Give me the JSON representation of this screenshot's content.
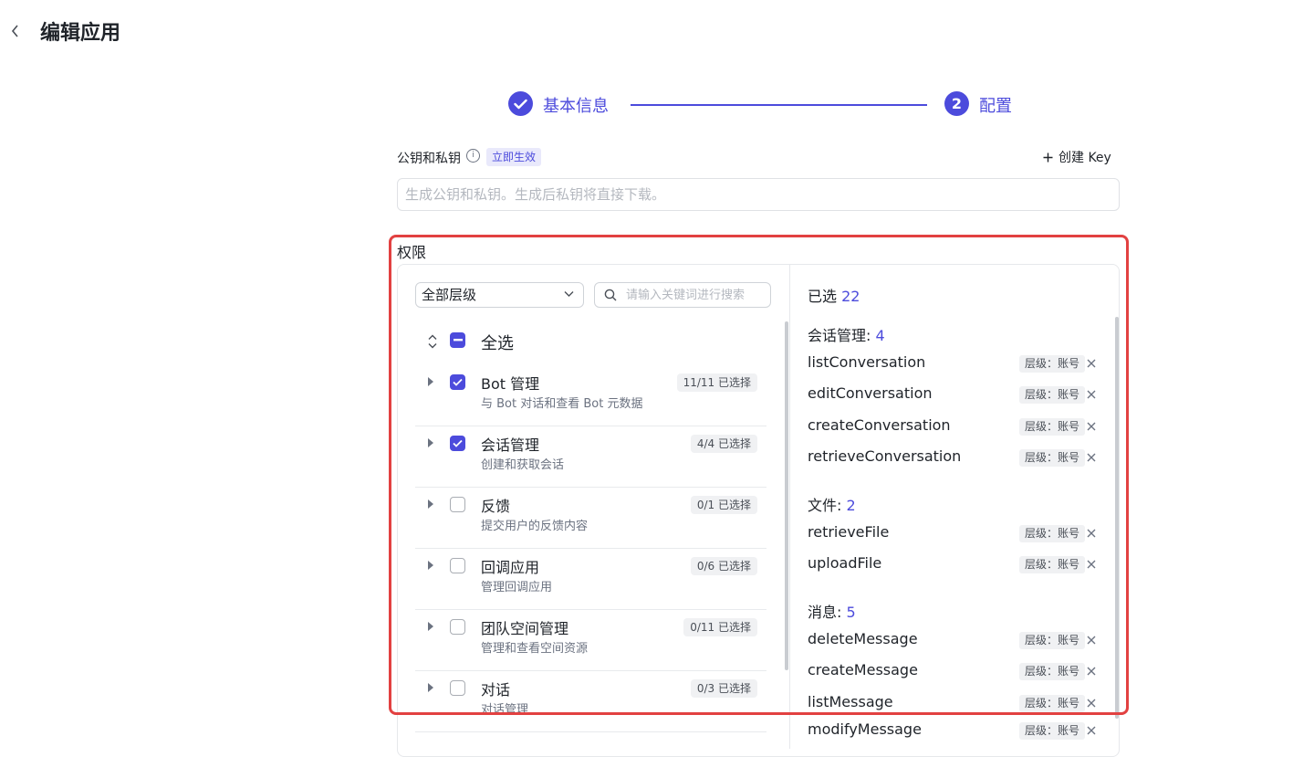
{
  "header": {
    "title": "编辑应用"
  },
  "steps": [
    {
      "label": "基本信息",
      "status": "done"
    },
    {
      "number": "2",
      "label": "配置",
      "status": "active"
    }
  ],
  "key_section": {
    "label": "公钥和私钥",
    "tag": "立即生效",
    "create_label": "创建 Key",
    "placeholder": "生成公钥和私钥。生成后私钥将直接下载。"
  },
  "permissions": {
    "label": "权限",
    "level_select": "全部层级",
    "search_placeholder": "请输入关键词进行搜索",
    "select_all": "全选",
    "groups": [
      {
        "name": "Bot 管理",
        "desc": "与 Bot 对话和查看 Bot 元数据",
        "badge": "11/11 已选择",
        "checked": true
      },
      {
        "name": "会话管理",
        "desc": "创建和获取会话",
        "badge": "4/4 已选择",
        "checked": true
      },
      {
        "name": "反馈",
        "desc": "提交用户的反馈内容",
        "badge": "0/1 已选择",
        "checked": false
      },
      {
        "name": "回调应用",
        "desc": "管理回调应用",
        "badge": "0/6 已选择",
        "checked": false
      },
      {
        "name": "团队空间管理",
        "desc": "管理和查看空间资源",
        "badge": "0/11 已选择",
        "checked": false
      },
      {
        "name": "对话",
        "desc": "对话管理",
        "badge": "0/3 已选择",
        "checked": false
      }
    ],
    "selected": {
      "label": "已选",
      "count": "22",
      "categories": [
        {
          "name": "会话管理:",
          "count": "4",
          "items": [
            "listConversation",
            "editConversation",
            "createConversation",
            "retrieveConversation"
          ]
        },
        {
          "name": "文件:",
          "count": "2",
          "items": [
            "retrieveFile",
            "uploadFile"
          ]
        },
        {
          "name": "消息:",
          "count": "5",
          "items": [
            "deleteMessage",
            "createMessage",
            "listMessage",
            "modifyMessage"
          ]
        }
      ],
      "level_tag": "层级：账号"
    }
  },
  "colors": {
    "accent": "#4c4bdc",
    "highlight": "#e24141"
  }
}
